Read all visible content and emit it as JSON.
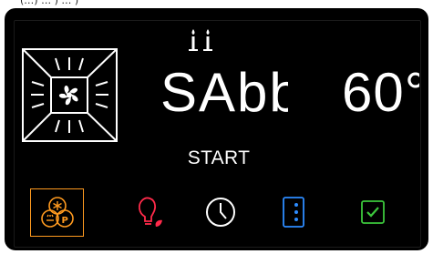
{
  "display": {
    "mode_text": "SAbb",
    "temperature_text": "60°",
    "start_label": "START"
  },
  "icons": {
    "sabbath": "candles-icon",
    "oven_mode": "fan-heat-icon",
    "functions": "fan-pizza-functions-icon",
    "light": "light-bulb-icon",
    "timer": "clock-icon",
    "options": "options-menu-icon",
    "confirm": "checkbox-confirm-icon"
  },
  "colors": {
    "functions_accent": "#ff9a1f",
    "light_accent": "#ff2a4a",
    "options_accent": "#2d8cff",
    "confirm_accent": "#3cc83c",
    "text": "#ffffff",
    "background": "#000000"
  }
}
